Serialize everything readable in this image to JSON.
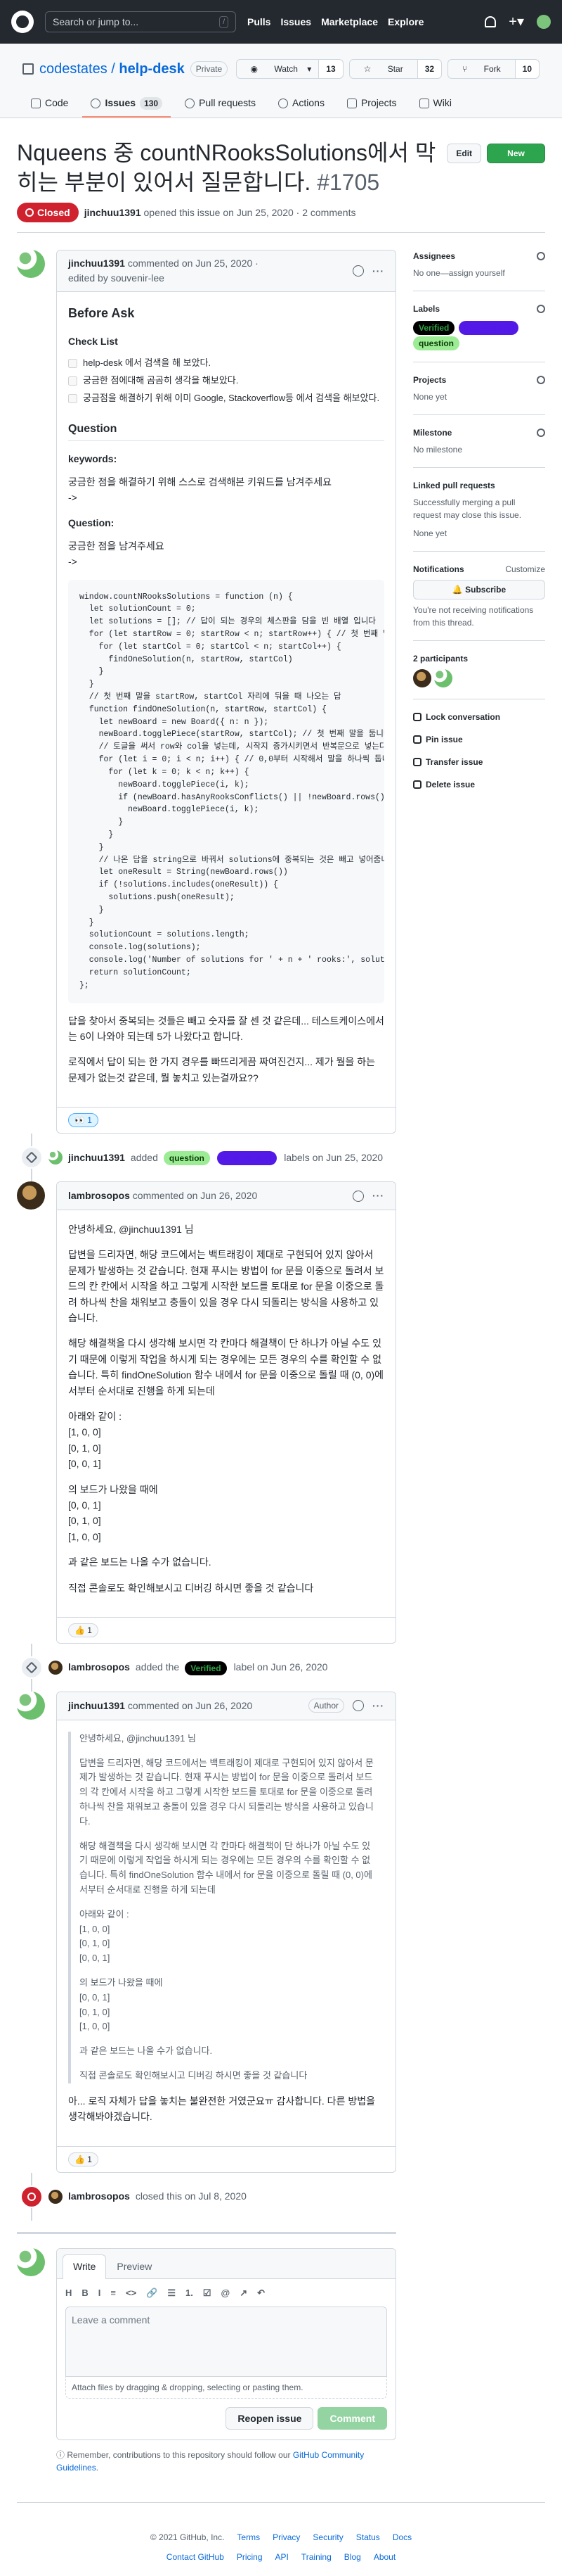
{
  "header": {
    "search_placeholder": "Search or jump to...",
    "search_key": "/",
    "nav": [
      "Pulls",
      "Issues",
      "Marketplace",
      "Explore"
    ]
  },
  "repo": {
    "owner": "codestates",
    "separator": "/",
    "name": "help-desk",
    "visibility": "Private",
    "watch_label": "Watch",
    "watch_count": "13",
    "star_label": "Star",
    "star_count": "32",
    "fork_label": "Fork",
    "fork_count": "10",
    "tabs": [
      {
        "label": "Code"
      },
      {
        "label": "Issues",
        "count": "130"
      },
      {
        "label": "Pull requests"
      },
      {
        "label": "Actions"
      },
      {
        "label": "Projects"
      },
      {
        "label": "Wiki"
      }
    ]
  },
  "issue": {
    "title": "Nqueens 중 countNRooksSolutions에서 막히는 부분이 있어서 질문합니다.",
    "number": "#1705",
    "edit_label": "Edit",
    "new_issue_label": "New issue",
    "status": "Closed",
    "author": "jinchuu1391",
    "meta": "opened this issue on Jun 25, 2020 · 2 comments"
  },
  "comment1": {
    "author": "jinchuu1391",
    "time": "commented on Jun 25, 2020 ·",
    "edited": "edited by souvenir-lee",
    "h_before": "Before Ask",
    "h_checklist": "Check List",
    "checks": [
      "help-desk 에서 검색을 해 보았다.",
      "궁금한 점에대해 곰곰히 생각을 해보았다.",
      "궁금점을 해결하기 위해 이미 Google, Stackoverflow등 에서 검색을 해보았다."
    ],
    "h_question": "Question",
    "h_keywords": "keywords:",
    "keywords_text": "궁금한 점을 해결하기 위해 스스로 검색해본 키워드를 남겨주세요",
    "arrow1": "->",
    "h_question2": "Question:",
    "question_text": "궁금한 점을 남겨주세요",
    "arrow2": "->",
    "code": "window.countNRooksSolutions = function (n) {\n  let solutionCount = 0;\n  let solutions = []; // 답이 되는 경우의 체스판을 담을 빈 배열 입니다\n  for (let startRow = 0; startRow < n; startRow++) { // 첫 번째 말\n    for (let startCol = 0; startCol < n; startCol++) {\n      findOneSolution(n, startRow, startCol)\n    }\n  }\n  // 첫 번째 말을 startRow, startCol 자리에 둬을 때 나오는 답\n  function findOneSolution(n, startRow, startCol) {\n    let newBoard = new Board({ n: n });\n    newBoard.togglePiece(startRow, startCol); // 첫 번째 말을 둡니다\n    // 토글을 써서 row와 col을 넣는데, 시작지 증가시키면서 반복문으로 넣는다\n    for (let i = 0; i < n; i++) { // 0,0부터 시작해서 말을 하나씩 둡니다.\n      for (let k = 0; k < n; k++) {\n        newBoard.togglePiece(i, k);\n        if (newBoard.hasAnyRooksConflicts() || !newBoard.rows())\n          newBoard.togglePiece(i, k);\n        }\n      }\n    }\n    // 나온 답을 string으로 바꿔서 solutions에 중복되는 것은 빼고 넣어줍니다\n    let oneResult = String(newBoard.rows())\n    if (!solutions.includes(oneResult)) {\n      solutions.push(oneResult);\n    }\n  }\n  solutionCount = solutions.length;\n  console.log(solutions);\n  console.log('Number of solutions for ' + n + ' rooks:', solut\n  return solutionCount;\n};",
    "after1": "답을 찾아서 중복되는 것들은 빼고 숫자를 잘 센 것 같은데... 테스트케이스에서는 6이 나와야 되는데 5가 나왔다고 합니다.",
    "after2": "로직에서 답이 되는 한 가지 경우를 빠뜨리게끔 짜여진건지... 제가 뭘을 하는 문제가 없는것 같은데, 뭘 놓치고 있는걸까요??",
    "reaction": "👀 1"
  },
  "event_labels": {
    "actor": "jinchuu1391",
    "verb": "added",
    "label1": "question",
    "label2": "help wanted",
    "suffix": "labels on Jun 25, 2020"
  },
  "comment2": {
    "author": "lambrosopos",
    "time": "commented on Jun 26, 2020",
    "greeting": "안녕하세요, @jinchuu1391 님",
    "p1": "답변을 드리자면, 해당 코드에서는 백트래킹이 제대로 구현되어 있지 않아서 문제가 발생하는 것 같습니다. 현재 푸시는 방법이 for 문을 이중으로 돌려서 보드의 칸 칸에서 시작을 하고 그렇게 시작한 보드를 토대로 for 문을 이중으로 돌려 하나씩 찬을 채워보고 충돌이 있을 경우 다시 되돌리는 방식을 사용하고 있습니다.",
    "p2": "해당 해결책을 다시 생각해 보시면 각 칸마다 해결책이 단 하나가 아닐 수도 있기 때문에 이렇게 작업을 하시게 되는 경우에는 모든 경우의 수를 확인할 수 없습니다. 특히 findOneSolution 함수 내에서 for 문을 이중으로 돌릴 때 (0, 0)에서부터 순서대로 진행을 하게 되는데",
    "p3": "아래와 같이 :",
    "m1": [
      "[1, 0, 0]",
      "[0, 1, 0]",
      "[0, 0, 1]"
    ],
    "p4": "의 보드가 나왔을 때에",
    "m2": [
      "[0, 0, 1]",
      "[0, 1, 0]",
      "[1, 0, 0]"
    ],
    "p5": "과 같은 보드는 나올 수가 없습니다.",
    "p6": "직접 콘솔로도 확인해보시고 디버깅 하시면 좋을 것 같습니다",
    "reaction": "👍 1"
  },
  "event_verified": {
    "actor": "lambrosopos",
    "verb": "added the",
    "label": "Verified",
    "suffix": "label on Jun 26, 2020"
  },
  "comment3": {
    "author": "jinchuu1391",
    "time": "commented on Jun 26, 2020",
    "badge": "Author",
    "q_greeting": "안녕하세요, @jinchuu1391 님",
    "q_p1": "답변을 드리자면, 해당 코드에서는 백트래킹이 제대로 구현되어 있지 않아서 문제가 발생하는 것 같습니다. 현재 푸시는 방법이 for 문을 이중으로 돌려서 보드의 각 칸에서 시작을 하고 그렇게 시작한 보드를 토대로 for 문을 이중으로 돌려 하나씩 찬을 채워보고 충돌이 있을 경우 다시 되돌리는 방식을 사용하고 있습니다.",
    "q_p2": "해당 해결책을 다시 생각해 보시면 각 칸마다 해결책이 단 하나가 아닐 수도 있기 때문에 이렇게 작업을 하시게 되는 경우에는 모든 경우의 수를 확인할 수 없습니다. 특히 findOneSolution 함수 내에서 for 문을 이중으로 돌릴 때 (0, 0)에서부터 순서대로 진행을 하게 되는데",
    "q_p3": "아래와 같이 :",
    "q_m1": [
      "[1, 0, 0]",
      "[0, 1, 0]",
      "[0, 0, 1]"
    ],
    "q_p4": "의 보드가 나왔을 때에",
    "q_m2": [
      "[0, 0, 1]",
      "[0, 1, 0]",
      "[1, 0, 0]"
    ],
    "q_p5": "과 같은 보드는 나올 수가 없습니다.",
    "q_p6": "직접 콘솔로도 확인해보시고 디버깅 하시면 좋을 것 같습니다",
    "reply": "아... 로직 자체가 답을 놓치는 불완전한 거였군요ㅠ 감사합니다. 다른 방법을 생각해봐야겠습니다.",
    "reaction": "👍 1"
  },
  "event_closed": {
    "actor": "lambrosopos",
    "suffix": "closed this on Jul 8, 2020"
  },
  "new_comment": {
    "tab_write": "Write",
    "tab_preview": "Preview",
    "tools": [
      "H",
      "B",
      "I",
      "≡",
      "<>",
      "🔗",
      "☰",
      "1.",
      "☑",
      "@",
      "↗",
      "↶"
    ],
    "placeholder": "Leave a comment",
    "attach": "Attach files by dragging & dropping, selecting or pasting them.",
    "reopen": "Reopen issue",
    "submit": "Comment",
    "note": "Remember, contributions to this repository should follow our",
    "note_link": "GitHub Community Guidelines",
    "note_end": "."
  },
  "sidebar": {
    "assignees_h": "Assignees",
    "assignees_v": "No one—assign yourself",
    "labels_h": "Labels",
    "labels": [
      "Verified",
      "help wanted",
      "question"
    ],
    "projects_h": "Projects",
    "projects_v": "None yet",
    "milestone_h": "Milestone",
    "milestone_v": "No milestone",
    "linked_h": "Linked pull requests",
    "linked_text": "Successfully merging a pull request may close this issue.",
    "linked_v": "None yet",
    "notif_h": "Notifications",
    "customize": "Customize",
    "subscribe": "Subscribe",
    "notif_text": "You're not receiving notifications from this thread.",
    "participants_h": "2 participants",
    "lock": "Lock conversation",
    "pin": "Pin issue",
    "transfer": "Transfer issue",
    "delete": "Delete issue"
  },
  "footer": {
    "copy": "© 2021 GitHub, Inc.",
    "row1": [
      "Terms",
      "Privacy",
      "Security",
      "Status",
      "Docs"
    ],
    "row2": [
      "Contact GitHub",
      "Pricing",
      "API",
      "Training",
      "Blog",
      "About"
    ]
  },
  "colors": {
    "closed": "#cf222e",
    "green": "#2da44e",
    "accent": "#0969da"
  }
}
